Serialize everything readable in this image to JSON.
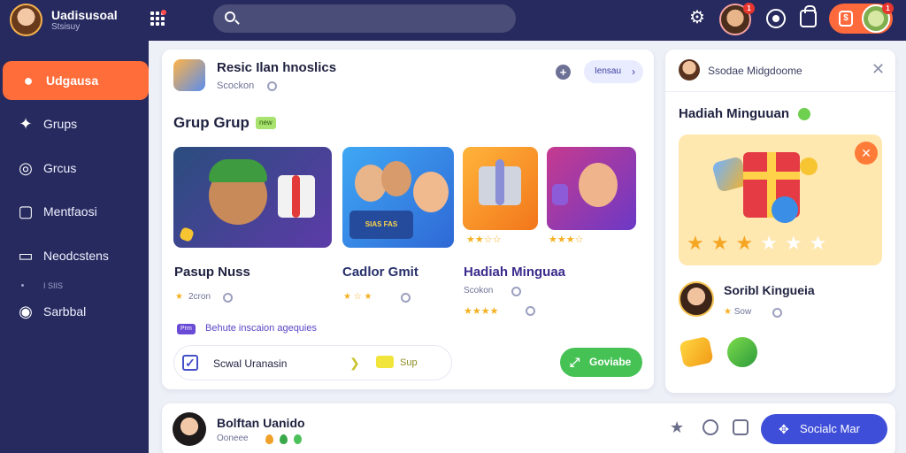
{
  "header": {
    "app_title": "Uadisusoal",
    "app_subtitle": "Stsisuy",
    "search_placeholder": "",
    "friends_badge": "1",
    "coins_badge": "1"
  },
  "sidebar": {
    "items": [
      {
        "label": "Udgausa",
        "icon": "chat-bubble-icon",
        "active": true
      },
      {
        "label": "Grups",
        "icon": "bird-icon"
      },
      {
        "label": "Grcus",
        "icon": "face-icon"
      },
      {
        "label": "Mentfaosi",
        "icon": "frame-icon"
      },
      {
        "label": "Neodcstens",
        "icon": "monitor-icon"
      },
      {
        "label": "Sarbbal",
        "icon": "settings-icon"
      }
    ],
    "separator": "I SIIS"
  },
  "group": {
    "title": "Resic Ilan hnoslics",
    "subtitle": "Scockon",
    "view_button": "Iensau",
    "section_title": "Grup Grup",
    "section_tag": "new",
    "tiles": [
      {
        "title": "Pasup Nuss",
        "meta": "2cron",
        "stars": "★"
      },
      {
        "title": "Cadlor Gmit",
        "meta": "",
        "stars": "★ ☆ ★"
      },
      {
        "title": "Hadiah Minguaa",
        "meta": "Scokon",
        "stars": "★★★★"
      }
    ],
    "tile_3_stars": "★★☆☆",
    "tile_4_stars": "★★★☆",
    "tile_2_caption": "SIAS FAS",
    "promo_tag": "Prm",
    "promo_text": "Behute inscaion agequies",
    "action_label": "Scwal Uranasin",
    "action_extra": "Sup",
    "join_button": "Goviabe"
  },
  "right_panel": {
    "user_name": "Ssodae Midgdoome",
    "title": "Hadiah Minguuan",
    "stars_filled": 3,
    "stars_total": 6,
    "user2_name": "Soribl Kingueia",
    "user2_meta": "Sow"
  },
  "post": {
    "name": "Bolftan Uanido",
    "meta": "Ooneee",
    "social_button": "Socialc Mar"
  },
  "colors": {
    "nav_bg": "#272a5e",
    "accent_orange": "#ff6d3a",
    "accent_green": "#46c255",
    "accent_blue": "#3e4ed8"
  }
}
